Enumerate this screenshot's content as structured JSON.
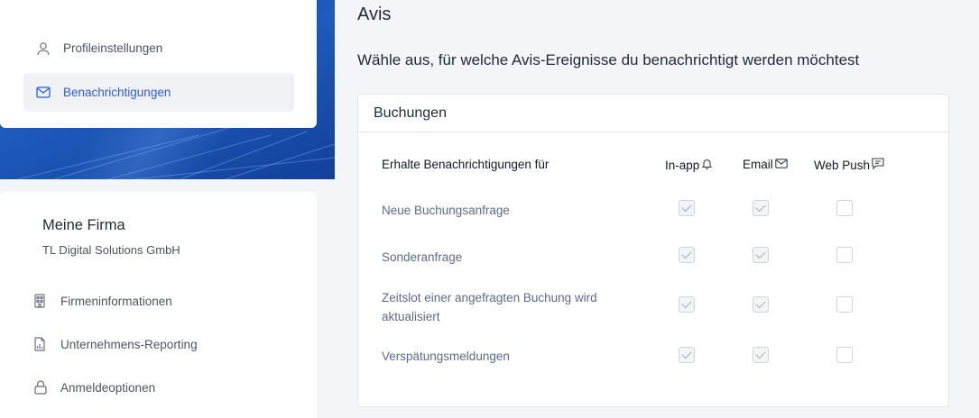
{
  "sidebar": {
    "profile_label": "Profileinstellungen",
    "notifications_label": "Benachrichtigungen",
    "company": {
      "title": "Meine Firma",
      "name": "TL Digital Solutions GmbH",
      "items": [
        {
          "label": "Firmeninformationen",
          "icon": "building-icon"
        },
        {
          "label": "Unternehmens-Reporting",
          "icon": "report-icon"
        },
        {
          "label": "Anmeldeoptionen",
          "icon": "lock-icon"
        }
      ]
    }
  },
  "main": {
    "title": "Avis",
    "subtitle": "Wähle aus, für welche Avis-Ereignisse du benachrichtigt werden möchtest",
    "section": {
      "title": "Buchungen",
      "header_label": "Erhalte Benachrichtigungen für",
      "columns": [
        {
          "label": "In-app",
          "icon": "bell-icon"
        },
        {
          "label": "Email",
          "icon": "mail-icon"
        },
        {
          "label": "Web Push",
          "icon": "message-icon"
        }
      ],
      "rows": [
        {
          "label": "Neue Buchungsanfrage",
          "inapp": true,
          "email": true,
          "webpush": false
        },
        {
          "label": "Sonderanfrage",
          "inapp": true,
          "email": true,
          "webpush": false
        },
        {
          "label": "Zeitslot einer angefragten Buchung wird aktualisiert",
          "inapp": true,
          "email": true,
          "webpush": false
        },
        {
          "label": "Verspätungsmeldungen",
          "inapp": true,
          "email": true,
          "webpush": false
        }
      ]
    }
  },
  "colors": {
    "accent": "#2f5bd6",
    "band": "#1e5bbd"
  }
}
